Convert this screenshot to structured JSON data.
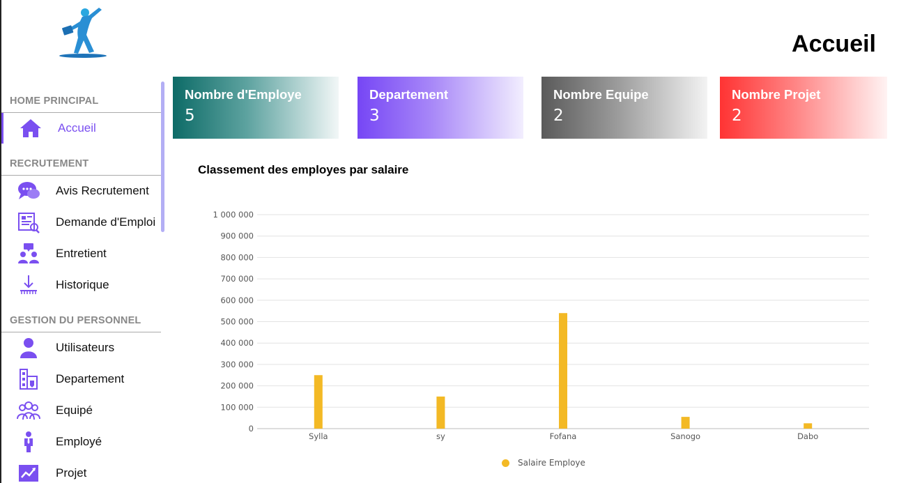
{
  "header": {
    "title": "Accueil"
  },
  "sidebar": {
    "sections": [
      {
        "title": "HOME PRINCIPAL",
        "items": [
          {
            "label": "Accueil",
            "icon": "home-icon",
            "active": true
          }
        ]
      },
      {
        "title": "RECRUTEMENT",
        "items": [
          {
            "label": "Avis Recrutement",
            "icon": "chat-bubbles-icon"
          },
          {
            "label": "Demande d'Emploi",
            "icon": "application-form-icon"
          },
          {
            "label": "Entretient",
            "icon": "interview-icon"
          },
          {
            "label": "Historique",
            "icon": "history-download-icon"
          }
        ]
      },
      {
        "title": "GESTION DU PERSONNEL",
        "items": [
          {
            "label": "Utilisateurs",
            "icon": "user-icon"
          },
          {
            "label": "Departement",
            "icon": "building-icon"
          },
          {
            "label": "Equipé",
            "icon": "team-icon"
          },
          {
            "label": "Employé",
            "icon": "employee-icon"
          },
          {
            "label": "Projet",
            "icon": "project-chart-icon"
          }
        ]
      }
    ]
  },
  "cards": [
    {
      "label": "Nombre d'Employe",
      "value": "5"
    },
    {
      "label": "Departement",
      "value": "3"
    },
    {
      "label": "Nombre Equipe",
      "value": "2"
    },
    {
      "label": "Nombre Projet",
      "value": "2"
    }
  ],
  "chart": {
    "title": "Classement des employes par salaire",
    "legend": "Salaire Employe"
  },
  "colors": {
    "accent": "#7a4ff0",
    "bar": "#f3b925"
  },
  "chart_data": {
    "type": "bar",
    "title": "Classement des employes par salaire",
    "categories": [
      "Sylla",
      "sy",
      "Fofana",
      "Sanogo",
      "Dabo"
    ],
    "series": [
      {
        "name": "Salaire Employe",
        "values": [
          250000,
          150000,
          540000,
          55000,
          25000
        ]
      }
    ],
    "ylim": [
      0,
      1000000
    ],
    "yticks": [
      "0",
      "100 000",
      "200 000",
      "300 000",
      "400 000",
      "500 000",
      "600 000",
      "700 000",
      "800 000",
      "900 000",
      "1 000 000"
    ],
    "grid": true,
    "legend_position": "bottom"
  }
}
